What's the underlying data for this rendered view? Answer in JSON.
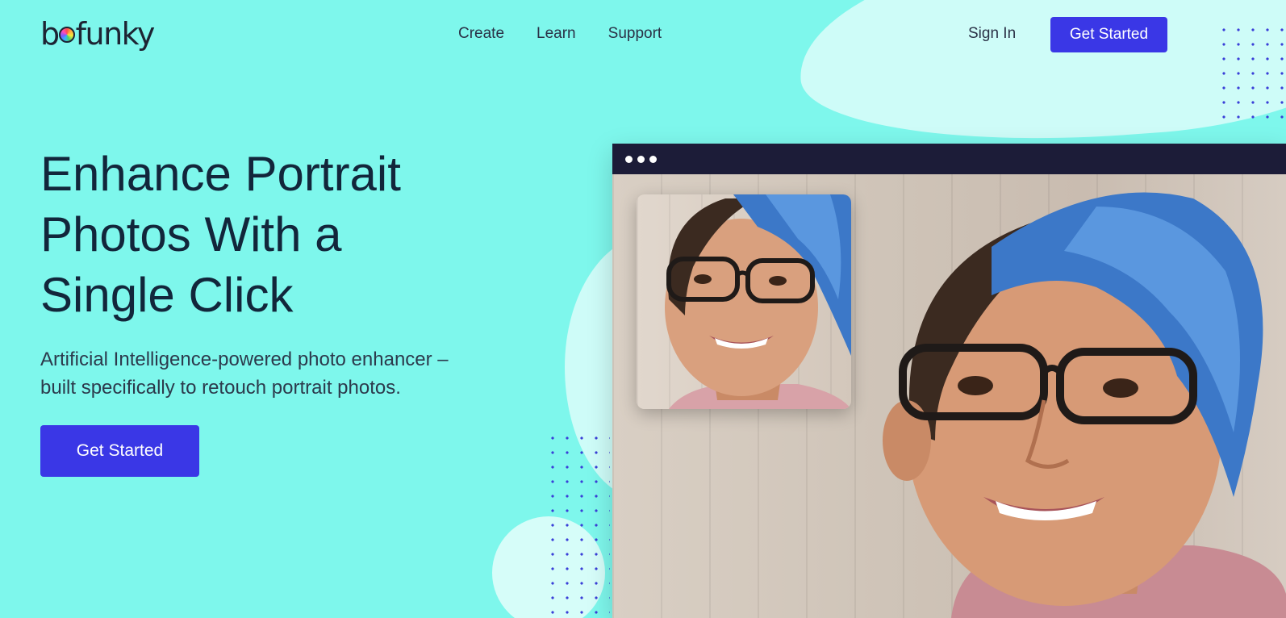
{
  "header": {
    "logo_text": "befunky",
    "nav": [
      "Create",
      "Learn",
      "Support"
    ],
    "signin_label": "Sign In",
    "cta_label": "Get Started"
  },
  "hero": {
    "title_lines": [
      "Enhance Portrait",
      "Photos With a",
      "Single Click"
    ],
    "subtitle_lines": [
      "Artificial Intelligence-powered photo enhancer –",
      "built specifically to retouch portrait photos."
    ],
    "cta_label": "Get Started"
  },
  "colors": {
    "background": "#7ef7ec",
    "accent": "#3a37e6",
    "window_bar": "#1c1c38"
  },
  "icons": [
    "logo-color-wheel-icon",
    "window-dots-icon"
  ]
}
